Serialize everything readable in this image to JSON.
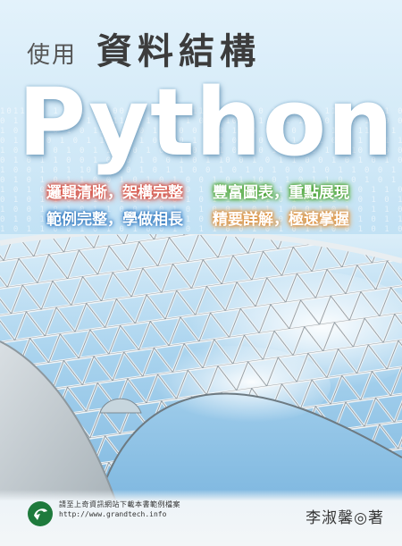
{
  "cover": {
    "prefix": "使用",
    "subtitle": "資料結構",
    "title": "Python",
    "features": [
      {
        "text": "邏輯清晰，架構完整",
        "color": "#e04a38"
      },
      {
        "text": "豐富圖表，重點展現",
        "color": "#52aa34"
      },
      {
        "text": "範例完整，學做相長",
        "color": "#3a82c8"
      },
      {
        "text": "精要詳解，極速掌握",
        "color": "#e69438"
      }
    ],
    "publisher_note": "請至上奇資訊網站下載本書範例檔案",
    "publisher_url": "http://www.grandtech.info",
    "author": "李淑馨◎著"
  }
}
